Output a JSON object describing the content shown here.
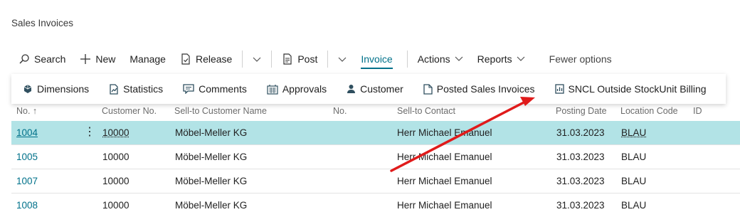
{
  "page": {
    "title": "Sales Invoices"
  },
  "actionbar": {
    "search": "Search",
    "new": "New",
    "manage": "Manage",
    "release": "Release",
    "post": "Post",
    "invoice": "Invoice",
    "actions": "Actions",
    "reports": "Reports",
    "fewer_options": "Fewer options"
  },
  "promoted": {
    "dimensions": "Dimensions",
    "statistics": "Statistics",
    "comments": "Comments",
    "approvals": "Approvals",
    "customer": "Customer",
    "posted_sales_invoices": "Posted Sales Invoices",
    "sncl_billing": "SNCL Outside StockUnit Billing"
  },
  "grid": {
    "headers": {
      "no": "No. ↑",
      "customer_no": "Customer No.",
      "sell_to_name": "Sell-to Customer Name",
      "no2": "No.",
      "sell_to_contact": "Sell-to Contact",
      "posting_date": "Posting Date",
      "location_code": "Location Code",
      "id": "ID"
    },
    "rows": [
      {
        "no": "1004",
        "customer_no": "10000",
        "name": "Möbel-Meller KG",
        "contact": "Herr Michael Emanuel",
        "date": "31.03.2023",
        "location": "BLAU"
      },
      {
        "no": "1005",
        "customer_no": "10000",
        "name": "Möbel-Meller KG",
        "contact": "Herr Michael Emanuel",
        "date": "31.03.2023",
        "location": "BLAU"
      },
      {
        "no": "1007",
        "customer_no": "10000",
        "name": "Möbel-Meller KG",
        "contact": "Herr Michael Emanuel",
        "date": "31.03.2023",
        "location": "BLAU"
      },
      {
        "no": "1008",
        "customer_no": "10000",
        "name": "Möbel-Meller KG",
        "contact": "Herr Michael Emanuel",
        "date": "31.03.2023",
        "location": "BLAU"
      }
    ],
    "row_menu": "⋮"
  },
  "colors": {
    "accent": "#00718a",
    "selected_row": "#b2e3e6",
    "arrow": "#e01b1b"
  }
}
